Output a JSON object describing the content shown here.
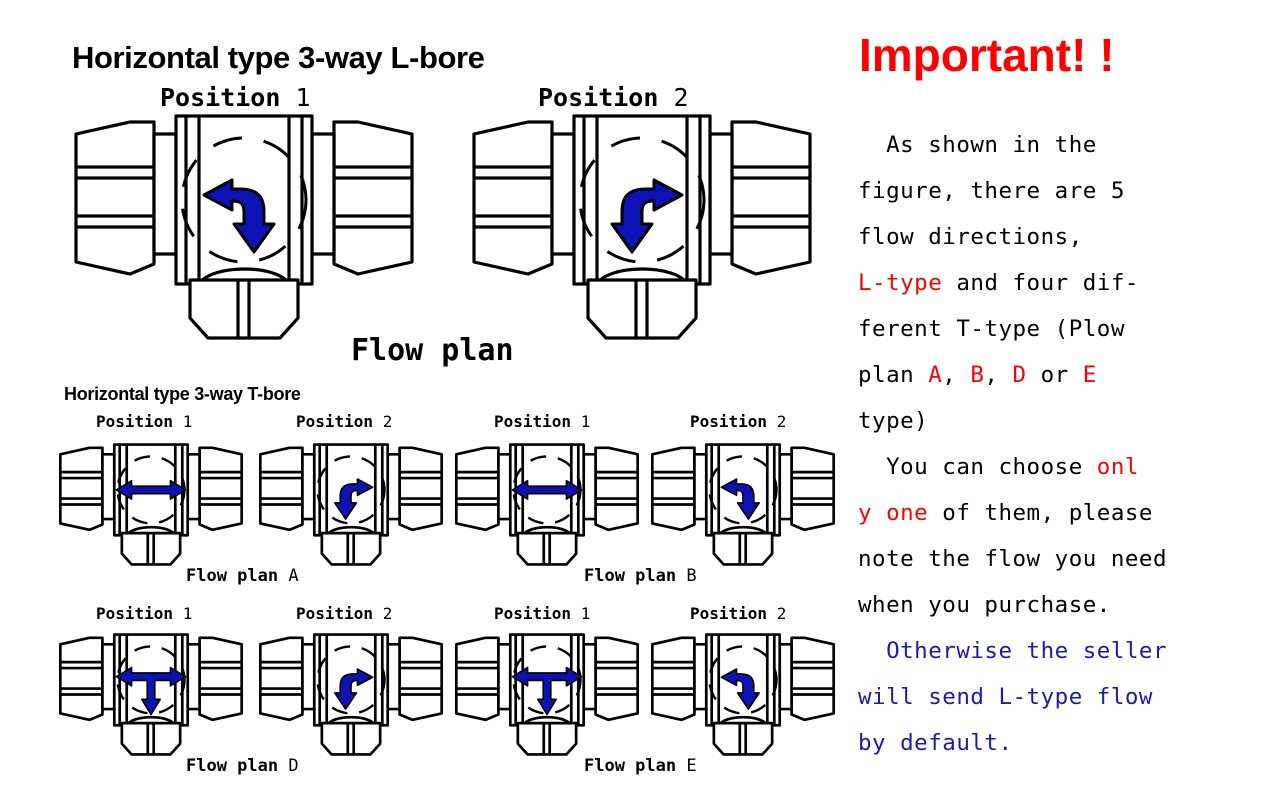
{
  "page": {
    "background": "#ffffff",
    "ink": "#000000",
    "arrow_blue": "#0c12b4",
    "accent_red": "#ff0000",
    "accent_blue": "#1a1ab4"
  },
  "left_diagram": {
    "lbore": {
      "title": "Horizontal type 3-way L-bore",
      "flow_plan_caption": "Flow plan",
      "valves": [
        {
          "position_label": "Position",
          "position_number": "1",
          "arrow": "l-arrow-left-down"
        },
        {
          "position_label": "Position",
          "position_number": "2",
          "arrow": "l-arrow-down-right"
        }
      ]
    },
    "tbore": {
      "title": "Horizontal type 3-way T-bore",
      "groups": [
        {
          "plan_caption": "Flow plan",
          "plan_letter": "A",
          "valves": [
            {
              "position_label": "Position",
              "position_number": "1",
              "arrow": "double-arrow-horizontal"
            },
            {
              "position_label": "Position",
              "position_number": "2",
              "arrow": "l-arrow-right-down"
            }
          ]
        },
        {
          "plan_caption": "Flow plan",
          "plan_letter": "B",
          "valves": [
            {
              "position_label": "Position",
              "position_number": "1",
              "arrow": "double-arrow-horizontal"
            },
            {
              "position_label": "Position",
              "position_number": "2",
              "arrow": "l-arrow-left-down"
            }
          ]
        },
        {
          "plan_caption": "Flow plan",
          "plan_letter": "D",
          "valves": [
            {
              "position_label": "Position",
              "position_number": "1",
              "arrow": "tee-arrow-left-right-down"
            },
            {
              "position_label": "Position",
              "position_number": "2",
              "arrow": "l-arrow-right-down"
            }
          ]
        },
        {
          "plan_caption": "Flow plan",
          "plan_letter": "E",
          "valves": [
            {
              "position_label": "Position",
              "position_number": "1",
              "arrow": "tee-arrow-left-right-down"
            },
            {
              "position_label": "Position",
              "position_number": "2",
              "arrow": "l-arrow-left-down"
            }
          ]
        }
      ]
    }
  },
  "notice": {
    "heading": "Important! !",
    "lines": [
      {
        "id": "l1",
        "segments": [
          {
            "text": "  As shown in the",
            "color": "black"
          }
        ]
      },
      {
        "id": "l2",
        "segments": [
          {
            "text": "figure, there are 5",
            "color": "black"
          }
        ]
      },
      {
        "id": "l3",
        "segments": [
          {
            "text": "flow directions,",
            "color": "black"
          }
        ]
      },
      {
        "id": "l4",
        "segments": [
          {
            "text": "L-type",
            "color": "red"
          },
          {
            "text": " and four dif-",
            "color": "black"
          }
        ]
      },
      {
        "id": "l5",
        "segments": [
          {
            "text": "ferent T-type (Plow",
            "color": "black"
          }
        ]
      },
      {
        "id": "l6",
        "segments": [
          {
            "text": "plan ",
            "color": "black"
          },
          {
            "text": "A",
            "color": "red"
          },
          {
            "text": ", ",
            "color": "black"
          },
          {
            "text": "B",
            "color": "red"
          },
          {
            "text": ", ",
            "color": "black"
          },
          {
            "text": "D",
            "color": "red"
          },
          {
            "text": " or ",
            "color": "black"
          },
          {
            "text": "E",
            "color": "red"
          }
        ]
      },
      {
        "id": "l7",
        "segments": [
          {
            "text": "type)",
            "color": "black"
          }
        ]
      },
      {
        "id": "l8",
        "segments": [
          {
            "text": "  You can choose ",
            "color": "black"
          },
          {
            "text": "onl",
            "color": "red"
          }
        ]
      },
      {
        "id": "l9",
        "segments": [
          {
            "text": "y one",
            "color": "red"
          },
          {
            "text": " of them, please",
            "color": "black"
          }
        ]
      },
      {
        "id": "l10",
        "segments": [
          {
            "text": "note the flow you need",
            "color": "black"
          }
        ]
      },
      {
        "id": "l11",
        "segments": [
          {
            "text": "when you purchase.",
            "color": "black"
          }
        ]
      },
      {
        "id": "l12",
        "segments": [
          {
            "text": "  Otherwise the seller",
            "color": "blue"
          }
        ]
      },
      {
        "id": "l13",
        "segments": [
          {
            "text": "will send L-type flow",
            "color": "blue"
          }
        ]
      },
      {
        "id": "l14",
        "segments": [
          {
            "text": "by default.",
            "color": "blue"
          }
        ]
      }
    ]
  }
}
